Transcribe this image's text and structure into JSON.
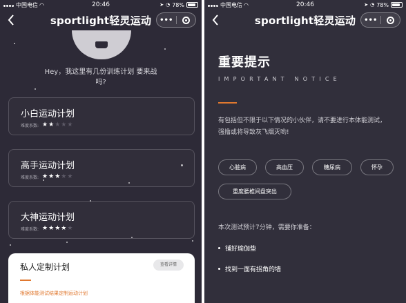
{
  "left_screen": {
    "status": {
      "carrier": "中国电信",
      "time": "20:46",
      "battery": "78%"
    },
    "nav": {
      "title": "sportlight轻灵运动",
      "more_icon": "•••"
    },
    "greeting": "Hey，我这里有几份训练计划 要来战吗?",
    "plans": [
      {
        "title": "小白运动计划",
        "difficulty_label": "难度系数:",
        "difficulty": 2,
        "max": 5
      },
      {
        "title": "高手运动计划",
        "difficulty_label": "难度系数:",
        "difficulty": 3,
        "max": 5
      },
      {
        "title": "大神运动计划",
        "difficulty_label": "难度系数:",
        "difficulty": 4,
        "max": 5
      }
    ],
    "custom": {
      "title": "私人定制计划",
      "button": "查看详情",
      "desc": "根据体能测试结果定制运动计划",
      "accent": "#e0782f"
    }
  },
  "right_screen": {
    "status": {
      "carrier": "中国电信",
      "time": "20:46",
      "battery": "78%"
    },
    "nav": {
      "title": "sportlight轻灵运动",
      "more_icon": "•••"
    },
    "title": "重要提示",
    "subtitle": "IMPORTANT NOTICE",
    "desc": "有包括但不限于以下情况的小伙伴，请不要进行本体能测试，强撸或将导致灰飞烟灭哟!",
    "tags": [
      "心脏病",
      "高血压",
      "糖尿病",
      "怀孕",
      "重度腰椎间盘突出"
    ],
    "prep_title": "本次测试预计7分钟，需要你准备：",
    "prep_items": [
      "铺好瑜伽垫",
      "找到一面有拐角的墙"
    ],
    "accent": "#e0782f"
  },
  "colors": {
    "background": "#2d2a37",
    "accent": "#e0782f"
  }
}
